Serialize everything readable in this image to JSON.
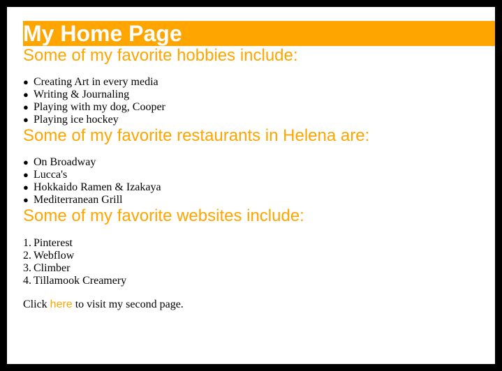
{
  "page": {
    "title": "My Home Page"
  },
  "hobbies": {
    "heading": "Some of my favorite hobbies include:",
    "items": [
      "Creating Art in every media",
      "Writing & Journaling",
      "Playing with my dog, Cooper",
      "Playing ice hockey"
    ]
  },
  "restaurants": {
    "heading": "Some of my favorite restaurants in Helena are:",
    "items": [
      "On Broadway",
      "Lucca's",
      "Hokkaido Ramen & Izakaya",
      "Mediterranean Grill"
    ]
  },
  "websites": {
    "heading": "Some of my favorite websites include:",
    "items": [
      "Pinterest",
      "Webflow",
      "Climber",
      "Tillamook Creamery"
    ],
    "numbers": [
      "1.",
      "2.",
      "3.",
      "4."
    ]
  },
  "footer": {
    "prefix": "Click ",
    "link_text": "here",
    "suffix": " to visit my second page."
  },
  "colors": {
    "accent": "#FFA500",
    "background": "#FFFFFF",
    "frame": "#000000",
    "text": "#000000"
  },
  "icons": {
    "bullet": "●"
  }
}
